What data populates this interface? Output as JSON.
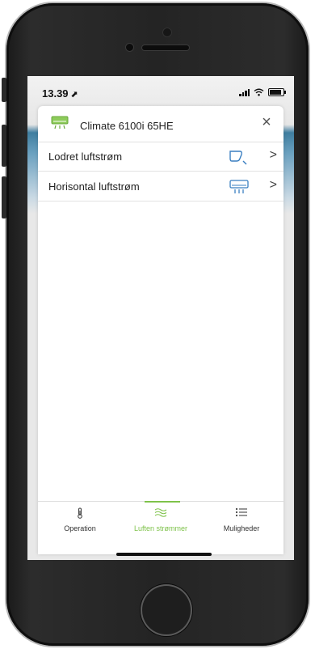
{
  "status_bar": {
    "time": "13.39",
    "location_arrow": "⬈"
  },
  "sheet": {
    "device_icon": "air-conditioner-icon",
    "title": "Climate 6100i 65HE",
    "close_label": "×"
  },
  "rows": [
    {
      "label": "Lodret luftstrøm",
      "icon": "vertical-airflow-icon",
      "chevron": ">"
    },
    {
      "label": "Horisontal luftstrøm",
      "icon": "horizontal-airflow-icon",
      "chevron": ">"
    }
  ],
  "tabs": [
    {
      "label": "Operation",
      "icon": "thermometer-icon",
      "active": false
    },
    {
      "label": "Luften strømmer",
      "icon": "airflow-waves-icon",
      "active": true
    },
    {
      "label": "Muligheder",
      "icon": "list-icon",
      "active": false
    }
  ],
  "colors": {
    "accent_green": "#7ec24a",
    "icon_blue": "#3a7fc1"
  }
}
